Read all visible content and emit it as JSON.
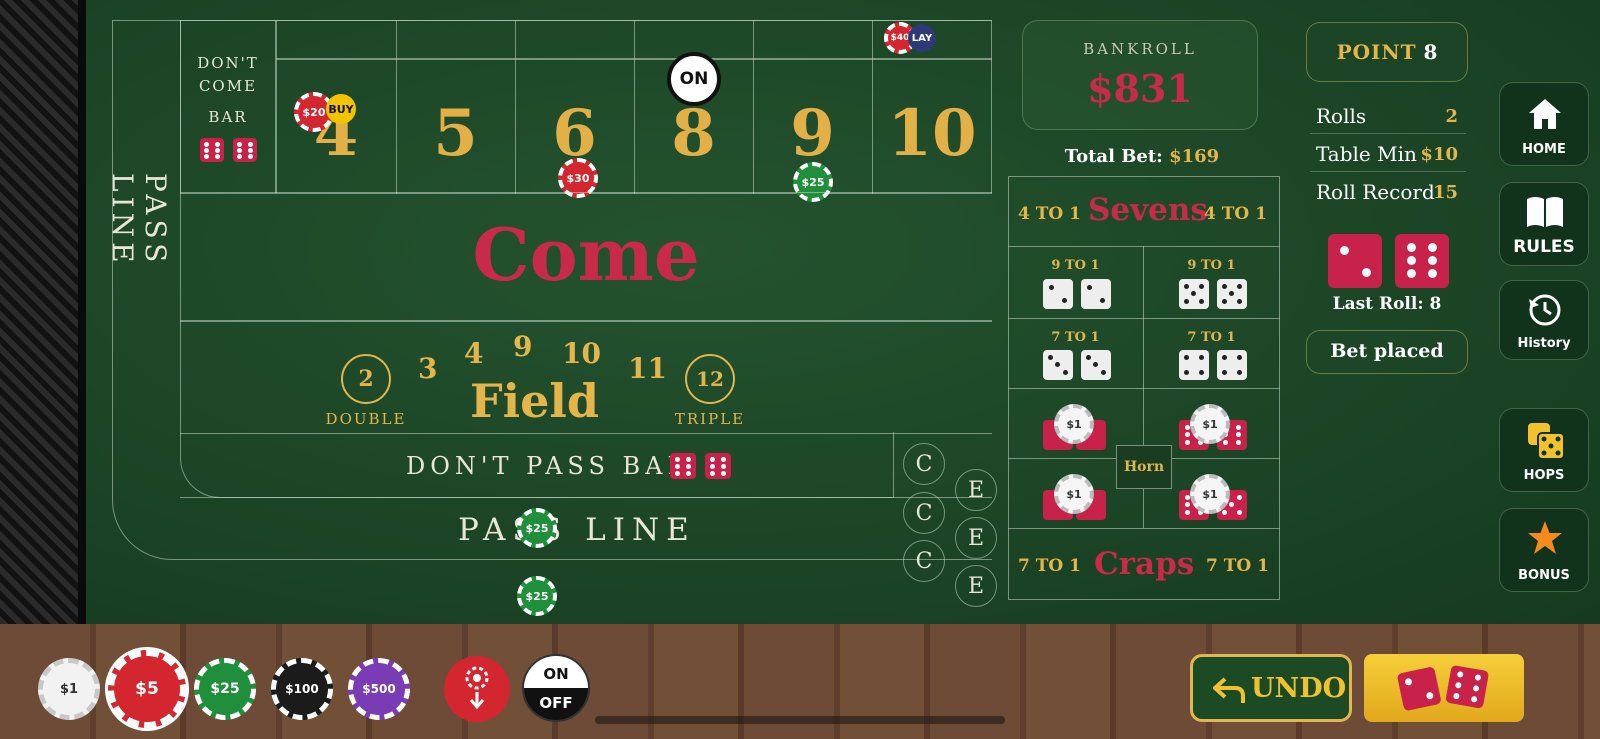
{
  "table": {
    "dont_come_line1": "DON'T",
    "dont_come_line2": "COME",
    "dont_come_line3": "BAR",
    "place_numbers": [
      "4",
      "5",
      "6",
      "8",
      "9",
      "10"
    ],
    "on_puck": "ON",
    "come": "Come",
    "field": "Field",
    "field_numbers": [
      "2",
      "3",
      "4",
      "9",
      "10",
      "11",
      "12"
    ],
    "field_double": "DOUBLE",
    "field_triple": "TRIPLE",
    "dont_pass_bar": "DON'T PASS BAR",
    "pass_line": "PASS LINE",
    "pass_line_vertical": "PASS LINE",
    "ce_c": "C",
    "ce_e": "E"
  },
  "chips_on_table": {
    "buy4_amount": "$20",
    "buy4_tag": "BUY",
    "lay10_amount": "$40",
    "lay10_tag": "LAY",
    "place6": "$30",
    "place9": "$25",
    "pass_line": "$25",
    "odds": "$25",
    "hard_chip": "$1"
  },
  "bankroll": {
    "label": "BANKROLL",
    "value": "$831"
  },
  "total_bet": {
    "label": "Total Bet:",
    "value": "$169"
  },
  "props": {
    "sevens": "Sevens",
    "sevens_odds": "4 TO 1",
    "hard_9to1": "9 TO 1",
    "hard_7to1": "7 TO 1",
    "horn": "Horn",
    "craps": "Craps",
    "craps_odds": "7 TO 1"
  },
  "status": {
    "point_label": "POINT",
    "point_value": "8",
    "rolls_label": "Rolls",
    "rolls_value": "2",
    "table_min_label": "Table Min",
    "table_min_value": "$10",
    "roll_record_label": "Roll Record",
    "roll_record_value": "15",
    "last_roll": "Last Roll: 8",
    "message": "Bet placed"
  },
  "nav": {
    "home": "HOME",
    "rules": "RULES",
    "history": "History",
    "hops": "HOPS",
    "bonus": "BONUS"
  },
  "chip_rack": {
    "chips": [
      "$1",
      "$5",
      "$25",
      "$100",
      "$500"
    ],
    "selected": "$5",
    "toggle_on": "ON",
    "toggle_off": "OFF"
  },
  "actions": {
    "undo": "UNDO"
  },
  "colors": {
    "felt": "#1c4526",
    "gold": "#e4b54a",
    "red": "#c82a4a",
    "accent_yellow": "#f2c12e"
  }
}
